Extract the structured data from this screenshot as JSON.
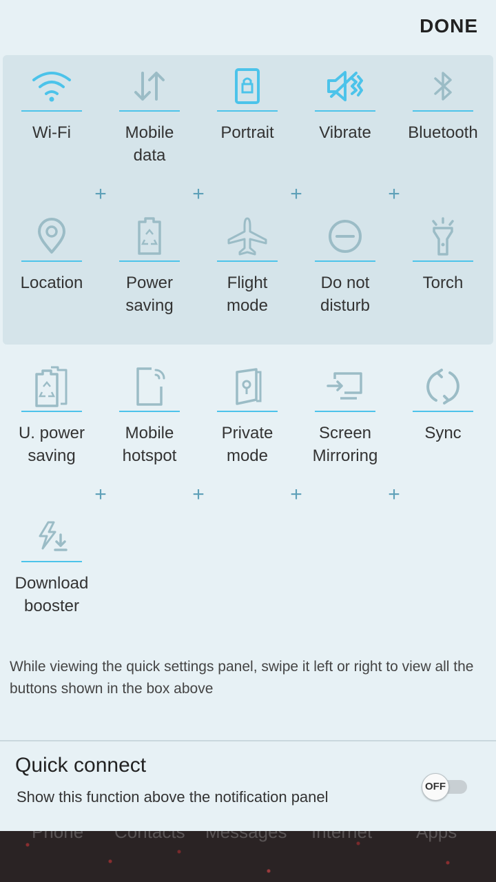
{
  "header": {
    "done_label": "DONE"
  },
  "active_tiles": [
    {
      "label": "Wi-Fi",
      "icon": "wifi-icon",
      "active": true
    },
    {
      "label": "Mobile\ndata",
      "icon": "mobile-data-icon",
      "active": false
    },
    {
      "label": "Portrait",
      "icon": "portrait-rotation-icon",
      "active": true
    },
    {
      "label": "Vibrate",
      "icon": "vibrate-icon",
      "active": true
    },
    {
      "label": "Bluetooth",
      "icon": "bluetooth-icon",
      "active": false
    },
    {
      "label": "Location",
      "icon": "location-icon",
      "active": false
    },
    {
      "label": "Power\nsaving",
      "icon": "power-saving-icon",
      "active": false
    },
    {
      "label": "Flight\nmode",
      "icon": "flight-mode-icon",
      "active": false
    },
    {
      "label": "Do not\ndisturb",
      "icon": "do-not-disturb-icon",
      "active": false
    },
    {
      "label": "Torch",
      "icon": "torch-icon",
      "active": false
    }
  ],
  "extra_tiles": [
    {
      "label": "U. power\nsaving",
      "icon": "ultra-power-saving-icon"
    },
    {
      "label": "Mobile\nhotspot",
      "icon": "mobile-hotspot-icon"
    },
    {
      "label": "Private\nmode",
      "icon": "private-mode-icon"
    },
    {
      "label": "Screen\nMirroring",
      "icon": "screen-mirroring-icon"
    },
    {
      "label": "Sync",
      "icon": "sync-icon"
    },
    {
      "label": "Download\nbooster",
      "icon": "download-booster-icon"
    }
  ],
  "hint_text": "While viewing the quick settings panel, swipe it left or right to view all the buttons shown in the box above",
  "quick_connect": {
    "title": "Quick connect",
    "description": "Show this function above the notification panel",
    "toggle_label": "OFF"
  },
  "dock": {
    "items": [
      "Phone",
      "Contacts",
      "Messages",
      "Internet",
      "Apps"
    ]
  },
  "colors": {
    "accent": "#4cc3ea",
    "inactive_icon": "#9bbcc6",
    "box_bg": "#d5e4ea",
    "page_bg": "#e7f1f5"
  }
}
